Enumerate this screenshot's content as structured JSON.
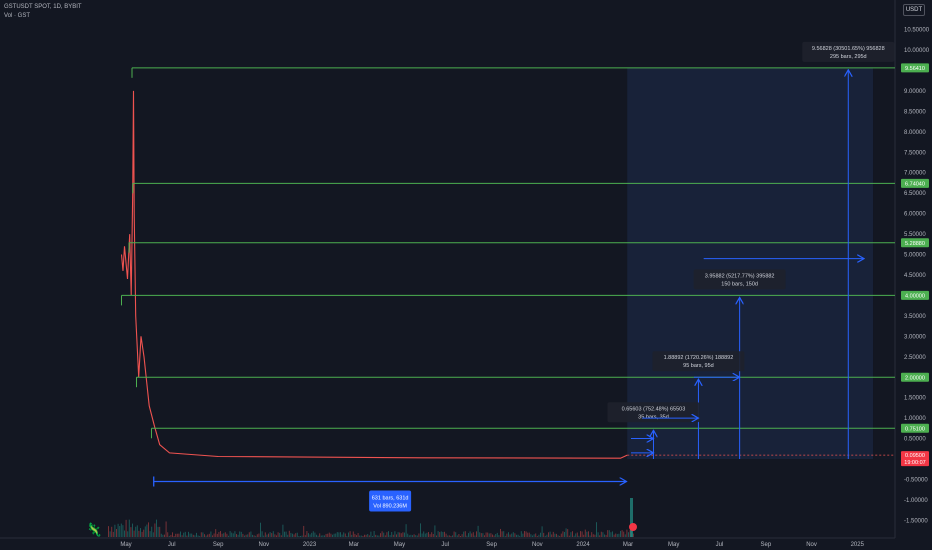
{
  "header": {
    "symbol_line": "GSTUSDT SPOT, 1D, BYBIT",
    "volume_line": "Vol · GST"
  },
  "currency_button": "USDT",
  "colors": {
    "background": "#131722",
    "level_line": "#4caf50",
    "measure_blue": "#2962ff",
    "candle_down": "#ef5350",
    "candle_up": "#26a69a",
    "zone_fill": "#1e2b4d"
  },
  "chart_data": {
    "type": "line",
    "title": "GSTUSDT SPOT, 1D, BYBIT",
    "ylim": [
      -1.5,
      10.5
    ],
    "y_ticks": [
      "10.50000",
      "10.00000",
      "9.00000",
      "8.50000",
      "8.00000",
      "7.50000",
      "7.00000",
      "6.50000",
      "6.00000",
      "5.50000",
      "5.00000",
      "4.50000",
      "3.50000",
      "3.00000",
      "2.50000",
      "1.50000",
      "1.00000",
      "0.50000",
      "-0.50000",
      "-1.00000",
      "-1.50000"
    ],
    "x_ticks": [
      "May",
      "Jul",
      "Sep",
      "Nov",
      "2023",
      "Mar",
      "May",
      "Jul",
      "Sep",
      "Nov",
      "2024",
      "Mar",
      "May",
      "Jul",
      "Sep",
      "Nov",
      "2025"
    ],
    "price_path": [
      {
        "date": "2022-04-25",
        "price": 5.0
      },
      {
        "date": "2022-04-27",
        "price": 4.6
      },
      {
        "date": "2022-04-29",
        "price": 5.2
      },
      {
        "date": "2022-05-03",
        "price": 4.4
      },
      {
        "date": "2022-05-06",
        "price": 5.5
      },
      {
        "date": "2022-05-08",
        "price": 4.0
      },
      {
        "date": "2022-05-10",
        "price": 6.5
      },
      {
        "date": "2022-05-11",
        "price": 9.0
      },
      {
        "date": "2022-05-12",
        "price": 6.0
      },
      {
        "date": "2022-05-14",
        "price": 3.5
      },
      {
        "date": "2022-05-18",
        "price": 2.0
      },
      {
        "date": "2022-05-21",
        "price": 3.0
      },
      {
        "date": "2022-05-25",
        "price": 2.5
      },
      {
        "date": "2022-06-01",
        "price": 1.3
      },
      {
        "date": "2022-06-08",
        "price": 0.8
      },
      {
        "date": "2022-06-15",
        "price": 0.35
      },
      {
        "date": "2022-06-28",
        "price": 0.15
      },
      {
        "date": "2022-09-01",
        "price": 0.06
      },
      {
        "date": "2023-06-01",
        "price": 0.03
      },
      {
        "date": "2024-02-20",
        "price": 0.02
      },
      {
        "date": "2024-02-29",
        "price": 0.095
      }
    ],
    "levels": [
      {
        "label": "9.56410",
        "value": 9.5641,
        "start": "2022-05-09"
      },
      {
        "label": "6.74040",
        "value": 6.7404,
        "start": "2022-05-10"
      },
      {
        "label": "5.28880",
        "value": 5.2888,
        "start": "2022-05-05"
      },
      {
        "label": "4.00000",
        "value": 4.0,
        "start": "2022-04-25"
      },
      {
        "label": "2.00000",
        "value": 2.0,
        "start": "2022-05-15"
      },
      {
        "label": "0.75100",
        "value": 0.751,
        "start": "2022-06-04"
      }
    ],
    "current_price": {
      "label": "0.09500",
      "countdown": "19:00:07",
      "value": 0.095
    },
    "measures": [
      {
        "line1": "9.56828 (30501.65%) 956828",
        "line2": "295 bars, 295d",
        "end": "2024-12-20",
        "top": 9.5641
      },
      {
        "line1": "3.95882 (5217.77%) 395882",
        "line2": "150 bars, 150d",
        "end": "2024-07-28",
        "top": 4.0
      },
      {
        "line1": "1.88892 (1720.26%) 188892",
        "line2": "95 bars, 95d",
        "end": "2024-06-03",
        "top": 2.0
      },
      {
        "line1": "0.65603 (752.48%) 65503",
        "line2": "35 bars, 35d",
        "end": "2024-04-04",
        "top": 0.751
      }
    ],
    "range_measure": {
      "line1": "631 bars, 631d",
      "line2": "Vol 890.236M",
      "start": "2022-06-07",
      "end": "2024-02-28",
      "value": -0.55
    },
    "arrows": [
      {
        "start": "2024-06-10",
        "end": "2025-01-10",
        "value": 4.9
      },
      {
        "start": "2024-05-28",
        "end": "2024-07-28",
        "value": 2.0
      },
      {
        "start": "2024-03-20",
        "end": "2024-06-03",
        "value": 1.0
      },
      {
        "start": "2024-03-05",
        "end": "2024-04-04",
        "value": 0.5
      },
      {
        "start": "2024-03-05",
        "end": "2024-04-04",
        "value": 0.15
      }
    ],
    "zone": {
      "start": "2024-02-29",
      "end": "2025-01-22",
      "top": 9.5641,
      "bottom": 0.0
    },
    "grid": false,
    "legend": "none"
  }
}
